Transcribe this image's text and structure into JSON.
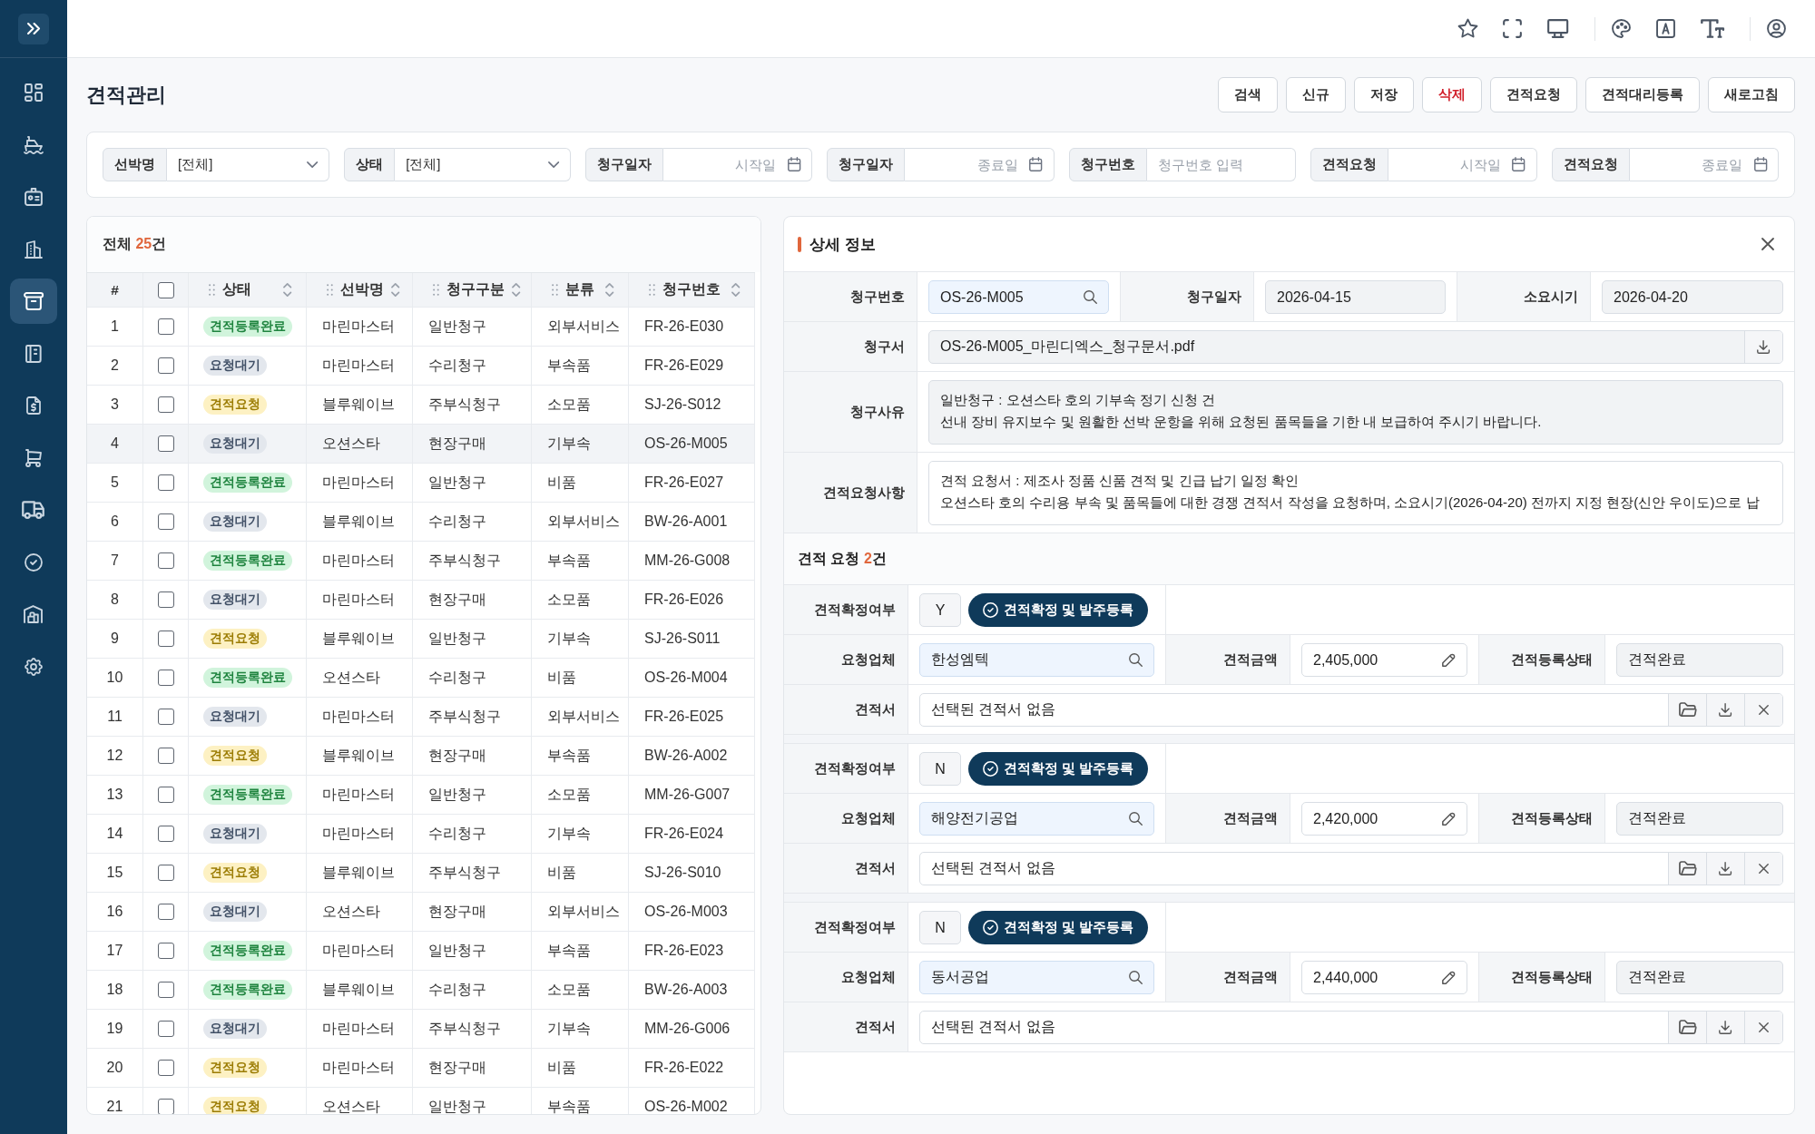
{
  "sidebar": {
    "items": [
      {
        "selected": false
      },
      {
        "selected": false
      },
      {
        "selected": false
      },
      {
        "selected": false
      },
      {
        "selected": true
      },
      {
        "selected": false
      },
      {
        "selected": false
      },
      {
        "selected": false
      },
      {
        "selected": false
      },
      {
        "selected": false
      },
      {
        "selected": false
      },
      {
        "selected": false
      }
    ]
  },
  "page": {
    "title": "견적관리",
    "actions": [
      {
        "label": "검색",
        "kind": "default"
      },
      {
        "label": "신규",
        "kind": "default"
      },
      {
        "label": "저장",
        "kind": "default"
      },
      {
        "label": "삭제",
        "kind": "danger"
      },
      {
        "label": "견적요청",
        "kind": "default"
      },
      {
        "label": "견적대리등록",
        "kind": "default"
      },
      {
        "label": "새로고침",
        "kind": "default"
      }
    ]
  },
  "filters": [
    {
      "label": "선박명",
      "kind": "select",
      "value": "[전체]"
    },
    {
      "label": "상태",
      "kind": "select",
      "value": "[전체]"
    },
    {
      "label": "청구일자",
      "kind": "date",
      "placeholder": "시작일"
    },
    {
      "label": "청구일자",
      "kind": "date",
      "placeholder": "종료일"
    },
    {
      "label": "청구번호",
      "kind": "text",
      "placeholder": "청구번호 입력"
    },
    {
      "label": "견적요청",
      "kind": "date",
      "placeholder": "시작일"
    },
    {
      "label": "견적요청",
      "kind": "date",
      "placeholder": "종료일"
    }
  ],
  "list": {
    "total": {
      "prefix": "전체 ",
      "count": "25",
      "suffix": "건"
    },
    "columns": [
      {
        "kind": "index",
        "label": "#"
      },
      {
        "kind": "checkbox",
        "checked": false
      },
      {
        "kind": "sortable",
        "label": "상태"
      },
      {
        "kind": "sortable",
        "label": "선박명"
      },
      {
        "kind": "sortable",
        "label": "청구구분"
      },
      {
        "kind": "sortable",
        "label": "분류"
      },
      {
        "kind": "sortable",
        "label": "청구번호"
      }
    ],
    "rows": [
      {
        "no": "1",
        "checked": false,
        "selected": false,
        "status": "견적등록완료",
        "color": "#d1f4dc",
        "vessel": "마린마스터",
        "claim_type": "일반청구",
        "category": "외부서비스",
        "claim_no": "FR-26-E030"
      },
      {
        "no": "2",
        "checked": false,
        "selected": false,
        "status": "요청대기",
        "color": "#e3e7ed",
        "vessel": "마린마스터",
        "claim_type": "수리청구",
        "category": "부속품",
        "claim_no": "FR-26-E029"
      },
      {
        "no": "3",
        "checked": false,
        "selected": false,
        "status": "견적요청",
        "color": "#fdf1c3",
        "vessel": "블루웨이브",
        "claim_type": "주부식청구",
        "category": "소모품",
        "claim_no": "SJ-26-S012"
      },
      {
        "no": "4",
        "checked": false,
        "selected": true,
        "status": "요청대기",
        "color": "#e3e7ed",
        "vessel": "오션스타",
        "claim_type": "현장구매",
        "category": "기부속",
        "claim_no": "OS-26-M005"
      },
      {
        "no": "5",
        "checked": false,
        "selected": false,
        "status": "견적등록완료",
        "color": "#d1f4dc",
        "vessel": "마린마스터",
        "claim_type": "일반청구",
        "category": "비품",
        "claim_no": "FR-26-E027"
      },
      {
        "no": "6",
        "checked": false,
        "selected": false,
        "status": "요청대기",
        "color": "#e3e7ed",
        "vessel": "블루웨이브",
        "claim_type": "수리청구",
        "category": "외부서비스",
        "claim_no": "BW-26-A001"
      },
      {
        "no": "7",
        "checked": false,
        "selected": false,
        "status": "견적등록완료",
        "color": "#d1f4dc",
        "vessel": "마린마스터",
        "claim_type": "주부식청구",
        "category": "부속품",
        "claim_no": "MM-26-G008"
      },
      {
        "no": "8",
        "checked": false,
        "selected": false,
        "status": "요청대기",
        "color": "#e3e7ed",
        "vessel": "마린마스터",
        "claim_type": "현장구매",
        "category": "소모품",
        "claim_no": "FR-26-E026"
      },
      {
        "no": "9",
        "checked": false,
        "selected": false,
        "status": "견적요청",
        "color": "#fdf1c3",
        "vessel": "블루웨이브",
        "claim_type": "일반청구",
        "category": "기부속",
        "claim_no": "SJ-26-S011"
      },
      {
        "no": "10",
        "checked": false,
        "selected": false,
        "status": "견적등록완료",
        "color": "#d1f4dc",
        "vessel": "오션스타",
        "claim_type": "수리청구",
        "category": "비품",
        "claim_no": "OS-26-M004"
      },
      {
        "no": "11",
        "checked": false,
        "selected": false,
        "status": "요청대기",
        "color": "#e3e7ed",
        "vessel": "마린마스터",
        "claim_type": "주부식청구",
        "category": "외부서비스",
        "claim_no": "FR-26-E025"
      },
      {
        "no": "12",
        "checked": false,
        "selected": false,
        "status": "견적요청",
        "color": "#fdf1c3",
        "vessel": "블루웨이브",
        "claim_type": "현장구매",
        "category": "부속품",
        "claim_no": "BW-26-A002"
      },
      {
        "no": "13",
        "checked": false,
        "selected": false,
        "status": "견적등록완료",
        "color": "#d1f4dc",
        "vessel": "마린마스터",
        "claim_type": "일반청구",
        "category": "소모품",
        "claim_no": "MM-26-G007"
      },
      {
        "no": "14",
        "checked": false,
        "selected": false,
        "status": "요청대기",
        "color": "#e3e7ed",
        "vessel": "마린마스터",
        "claim_type": "수리청구",
        "category": "기부속",
        "claim_no": "FR-26-E024"
      },
      {
        "no": "15",
        "checked": false,
        "selected": false,
        "status": "견적요청",
        "color": "#fdf1c3",
        "vessel": "블루웨이브",
        "claim_type": "주부식청구",
        "category": "비품",
        "claim_no": "SJ-26-S010"
      },
      {
        "no": "16",
        "checked": false,
        "selected": false,
        "status": "요청대기",
        "color": "#e3e7ed",
        "vessel": "오션스타",
        "claim_type": "현장구매",
        "category": "외부서비스",
        "claim_no": "OS-26-M003"
      },
      {
        "no": "17",
        "checked": false,
        "selected": false,
        "status": "견적등록완료",
        "color": "#d1f4dc",
        "vessel": "마린마스터",
        "claim_type": "일반청구",
        "category": "부속품",
        "claim_no": "FR-26-E023"
      },
      {
        "no": "18",
        "checked": false,
        "selected": false,
        "status": "견적등록완료",
        "color": "#d1f4dc",
        "vessel": "블루웨이브",
        "claim_type": "수리청구",
        "category": "소모품",
        "claim_no": "BW-26-A003"
      },
      {
        "no": "19",
        "checked": false,
        "selected": false,
        "status": "요청대기",
        "color": "#e3e7ed",
        "vessel": "마린마스터",
        "claim_type": "주부식청구",
        "category": "기부속",
        "claim_no": "MM-26-G006"
      },
      {
        "no": "20",
        "checked": false,
        "selected": false,
        "status": "견적요청",
        "color": "#fdf1c3",
        "vessel": "마린마스터",
        "claim_type": "현장구매",
        "category": "비품",
        "claim_no": "FR-26-E022"
      },
      {
        "no": "21",
        "checked": false,
        "selected": false,
        "status": "견적요청",
        "color": "#fdf1c3",
        "vessel": "오션스타",
        "claim_type": "일반청구",
        "category": "부속품",
        "claim_no": "OS-26-M002"
      }
    ]
  },
  "detail": {
    "title": "상세 정보",
    "fields": [
      {
        "label": "청구번호",
        "kind": "search",
        "readonly": false,
        "value": "OS-26-M005"
      },
      {
        "label": "청구일자",
        "kind": "text",
        "readonly": true,
        "value": "2026-04-15"
      },
      {
        "label": "소요시기",
        "kind": "text",
        "readonly": true,
        "value": "2026-04-20"
      },
      {
        "label": "청구서",
        "kind": "file",
        "readonly": true,
        "value": "OS-26-M005_마린디엑스_청구문서.pdf"
      },
      {
        "label": "청구사유",
        "kind": "textarea",
        "readonly": true,
        "value": "일반청구 : 오션스타 호의 기부속 정기 신청 건\n선내 장비 유지보수 및 원활한 선박 운항을 위해 요청된 품목들을 기한 내 보급하여 주시기 바랍니다."
      },
      {
        "label": "견적요청사항",
        "kind": "textarea",
        "readonly": false,
        "value": "견적 요청서 : 제조사 정품 신품 견적 및 긴급 납기 일정 확인\n오션스타 호의 수리용 부속 및 품목들에 대한 경쟁 견적서 작성을 요청하며, 소요시기(2026-04-20) 전까지 지정 현장(신안 우이도)으로 납"
      }
    ],
    "quotes": {
      "heading": {
        "prefix": "견적 요청 ",
        "count": "2",
        "suffix": "건"
      },
      "items": [
        {
          "confirm_label": "견적확정여부",
          "confirm_value": "Y",
          "action": "견적확정 및 발주등록",
          "vendor_label": "요청업체",
          "vendor": "한성엠텍",
          "amount_label": "견적금액",
          "amount": "2,405,000",
          "status_label": "견적등록상태",
          "status": "견적완료",
          "file_label": "견적서",
          "file": "선택된 견적서 없음"
        },
        {
          "confirm_label": "견적확정여부",
          "confirm_value": "N",
          "action": "견적확정 및 발주등록",
          "vendor_label": "요청업체",
          "vendor": "해양전기공업",
          "amount_label": "견적금액",
          "amount": "2,420,000",
          "status_label": "견적등록상태",
          "status": "견적완료",
          "file_label": "견적서",
          "file": "선택된 견적서 없음"
        },
        {
          "confirm_label": "견적확정여부",
          "confirm_value": "N",
          "action": "견적확정 및 발주등록",
          "vendor_label": "요청업체",
          "vendor": "동서공업",
          "amount_label": "견적금액",
          "amount": "2,440,000",
          "status_label": "견적등록상태",
          "status": "견적완료",
          "file_label": "견적서",
          "file": "선택된 견적서 없음"
        }
      ]
    }
  }
}
